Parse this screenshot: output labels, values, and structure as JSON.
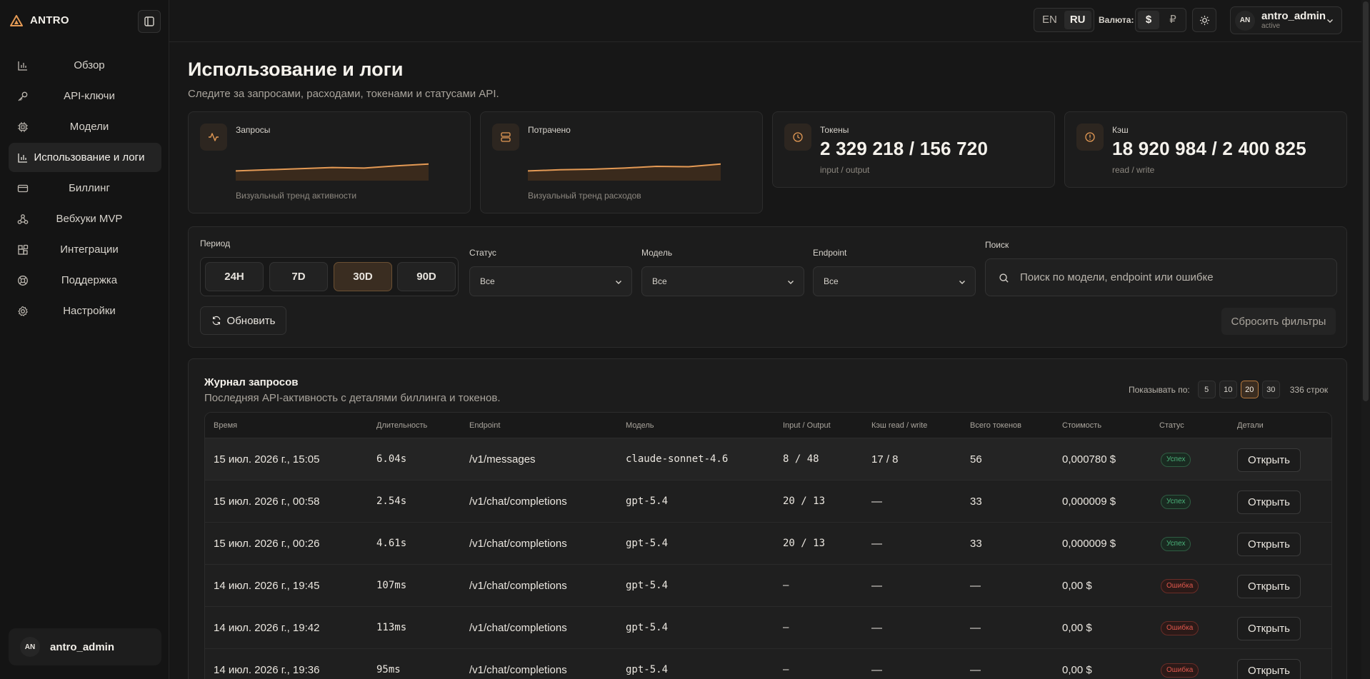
{
  "app": {
    "name": "ANTRO"
  },
  "sidebar": {
    "items": [
      {
        "label": "Обзор",
        "icon": "bar-chart-icon"
      },
      {
        "label": "API-ключи",
        "icon": "key-icon"
      },
      {
        "label": "Модели",
        "icon": "cpu-icon"
      },
      {
        "label": "Использование и логи",
        "icon": "bar-chart-icon",
        "active": true
      },
      {
        "label": "Биллинг",
        "icon": "credit-card-icon"
      },
      {
        "label": "Вебхуки MVP",
        "icon": "webhook-icon"
      },
      {
        "label": "Интеграции",
        "icon": "blocks-icon"
      },
      {
        "label": "Поддержка",
        "icon": "lifebuoy-icon"
      },
      {
        "label": "Настройки",
        "icon": "gear-icon"
      }
    ],
    "user": {
      "initials": "AN",
      "name": "antro_admin"
    }
  },
  "topbar": {
    "lang": {
      "en": "EN",
      "ru": "RU",
      "selected": "RU"
    },
    "currency_label": "Валюта:",
    "currency": {
      "usd": "$",
      "rub": "₽",
      "selected": "$"
    },
    "account": {
      "initials": "AN",
      "name": "antro_admin",
      "status": "active"
    }
  },
  "page": {
    "title": "Использование и логи",
    "subtitle": "Следите за запросами, расходами, токенами и статусами API."
  },
  "cards": {
    "requests": {
      "title": "Запросы",
      "caption": "Визуальный тренд активности",
      "trend": [
        0.35,
        0.45,
        0.55,
        0.65,
        0.6,
        0.8,
        0.95
      ]
    },
    "spent": {
      "title": "Потрачено",
      "caption": "Визуальный тренд расходов",
      "trend": [
        0.35,
        0.45,
        0.5,
        0.6,
        0.75,
        0.72,
        0.95
      ]
    },
    "tokens": {
      "title": "Токены",
      "value": "2 329 218 / 156 720",
      "sub": "input / output"
    },
    "cache": {
      "title": "Кэш",
      "value": "18 920 984 / 2 400 825",
      "sub": "read / write"
    }
  },
  "filters": {
    "period_label": "Период",
    "periods": [
      "24H",
      "7D",
      "30D",
      "90D"
    ],
    "selected_period": "30D",
    "status": {
      "label": "Статус",
      "value": "Все"
    },
    "model": {
      "label": "Модель",
      "value": "Все"
    },
    "endpoint": {
      "label": "Endpoint",
      "value": "Все"
    },
    "search": {
      "label": "Поиск",
      "placeholder": "Поиск по модели, endpoint или ошибке"
    },
    "refresh_label": "Обновить",
    "reset_label": "Сбросить фильтры"
  },
  "log": {
    "title": "Журнал запросов",
    "subtitle": "Последняя API-активность с деталями биллинга и токенов.",
    "per_page_label": "Показывать по:",
    "per_page_options": [
      "5",
      "10",
      "20",
      "30"
    ],
    "per_page_selected": "20",
    "row_count": "336 строк",
    "columns": [
      "Время",
      "Длительность",
      "Endpoint",
      "Модель",
      "Input / Output",
      "Кэш read / write",
      "Всего токенов",
      "Стоимость",
      "Статус",
      "Детали"
    ],
    "open_label": "Открыть",
    "rows": [
      {
        "time": "15 июл. 2026 г., 15:05",
        "duration": "6.04s",
        "endpoint": "/v1/messages",
        "model": "claude-sonnet-4.6",
        "io": "8 / 48",
        "cache": "17 / 8",
        "total": "56",
        "cost": "0,000780 $",
        "status": "Успех",
        "ok": true
      },
      {
        "time": "15 июл. 2026 г., 00:58",
        "duration": "2.54s",
        "endpoint": "/v1/chat/completions",
        "model": "gpt-5.4",
        "io": "20 / 13",
        "cache": "—",
        "total": "33",
        "cost": "0,000009 $",
        "status": "Успех",
        "ok": true
      },
      {
        "time": "15 июл. 2026 г., 00:26",
        "duration": "4.61s",
        "endpoint": "/v1/chat/completions",
        "model": "gpt-5.4",
        "io": "20 / 13",
        "cache": "—",
        "total": "33",
        "cost": "0,000009 $",
        "status": "Успех",
        "ok": true
      },
      {
        "time": "14 июл. 2026 г., 19:45",
        "duration": "107ms",
        "endpoint": "/v1/chat/completions",
        "model": "gpt-5.4",
        "io": "—",
        "cache": "—",
        "total": "—",
        "cost": "0,00 $",
        "status": "Ошибка",
        "ok": false
      },
      {
        "time": "14 июл. 2026 г., 19:42",
        "duration": "113ms",
        "endpoint": "/v1/chat/completions",
        "model": "gpt-5.4",
        "io": "—",
        "cache": "—",
        "total": "—",
        "cost": "0,00 $",
        "status": "Ошибка",
        "ok": false
      },
      {
        "time": "14 июл. 2026 г., 19:36",
        "duration": "95ms",
        "endpoint": "/v1/chat/completions",
        "model": "gpt-5.4",
        "io": "—",
        "cache": "—",
        "total": "—",
        "cost": "0,00 $",
        "status": "Ошибка",
        "ok": false
      }
    ]
  },
  "colors": {
    "accent": "#e49a55",
    "success": "#4bb37a",
    "error": "#e0574c",
    "background": "#171717"
  }
}
